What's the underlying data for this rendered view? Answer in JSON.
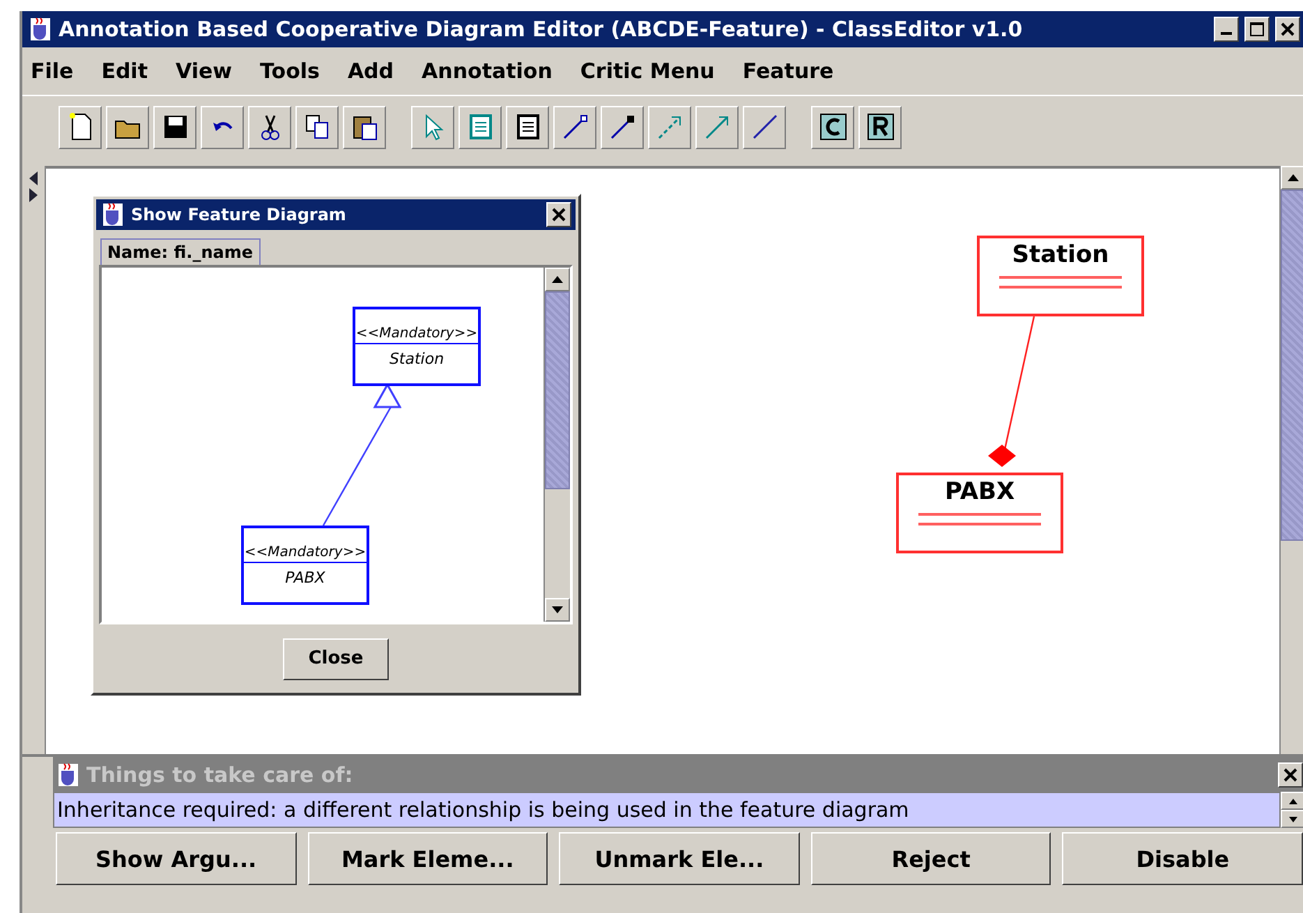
{
  "window": {
    "title": "Annotation Based Cooperative Diagram Editor (ABCDE-Feature) - ClassEditor v1.0"
  },
  "menu": [
    {
      "label": "File"
    },
    {
      "label": "Edit"
    },
    {
      "label": "View"
    },
    {
      "label": "Tools"
    },
    {
      "label": "Add"
    },
    {
      "label": "Annotation"
    },
    {
      "label": "Critic Menu"
    },
    {
      "label": "Feature"
    }
  ],
  "feature_dialog": {
    "title": "Show Feature Diagram",
    "tab": "Name: fi._name",
    "nodes": [
      {
        "stereotype": "<<Mandatory>>",
        "name": "Station"
      },
      {
        "stereotype": "<<Mandatory>>",
        "name": "PABX"
      }
    ],
    "button": "Close"
  },
  "class_diagram": {
    "classes": [
      {
        "name": "Station"
      },
      {
        "name": "PABX"
      }
    ]
  },
  "critic_panel": {
    "title": "Things to take care of:",
    "items": [
      {
        "text": "Inheritance required: a different relationship is being used in the feature diagram",
        "selected": true
      }
    ],
    "buttons": [
      "Show Argu...",
      "Mark Eleme...",
      "Unmark Ele...",
      "Reject",
      "Disable"
    ]
  }
}
